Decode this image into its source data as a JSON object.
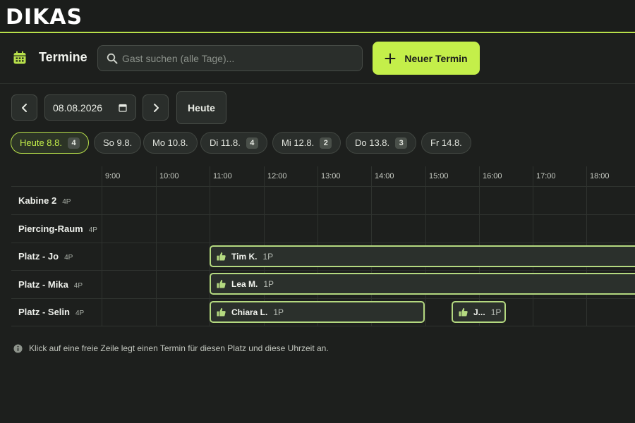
{
  "app": {
    "logo": "DIKAS"
  },
  "header": {
    "title": "Termine",
    "search_placeholder": "Gast suchen (alle Tage)...",
    "new_button": "Neuer Termin"
  },
  "datebar": {
    "date_value": "08.08.2026",
    "today_button": "Heute"
  },
  "day_tabs": [
    {
      "label": "Heute 8.8.",
      "count": "4",
      "active": true
    },
    {
      "label": "So 9.8.",
      "count": ""
    },
    {
      "label": "Mo 10.8.",
      "count": ""
    },
    {
      "label": "Di 11.8.",
      "count": "4"
    },
    {
      "label": "Mi 12.8.",
      "count": "2"
    },
    {
      "label": "Do 13.8.",
      "count": "3"
    },
    {
      "label": "Fr 14.8.",
      "count": ""
    }
  ],
  "timeline": {
    "hours": [
      "9:00",
      "10:00",
      "11:00",
      "12:00",
      "13:00",
      "14:00",
      "15:00",
      "16:00",
      "17:00",
      "18:00"
    ],
    "resources": [
      {
        "name": "Kabine 2",
        "capacity": "4P"
      },
      {
        "name": "Piercing-Raum",
        "capacity": "4P"
      },
      {
        "name": "Platz - Jo",
        "capacity": "4P"
      },
      {
        "name": "Platz - Mika",
        "capacity": "4P"
      },
      {
        "name": "Platz - Selin",
        "capacity": "4P"
      }
    ],
    "appointments": [
      {
        "name": "Tim K.",
        "persons": "1P",
        "resource": "Platz - Jo",
        "start": "11:00",
        "end": ""
      },
      {
        "name": "Lea M.",
        "persons": "1P",
        "resource": "Platz - Mika",
        "start": "11:00",
        "end": ""
      },
      {
        "name": "Chiara L.",
        "persons": "1P",
        "resource": "Platz - Selin",
        "start": "11:00",
        "end": "15:00"
      },
      {
        "name": "J...",
        "persons": "1P",
        "resource": "Platz - Selin",
        "start": "15:30",
        "end": "16:30"
      }
    ]
  },
  "hint": "Klick auf eine freie Zeile legt einen Termin für diesen Platz und diese Uhrzeit an.",
  "colors": {
    "accent": "#c4ef4a",
    "background": "#1d1f1d",
    "appointment_border": "#b4d980"
  }
}
